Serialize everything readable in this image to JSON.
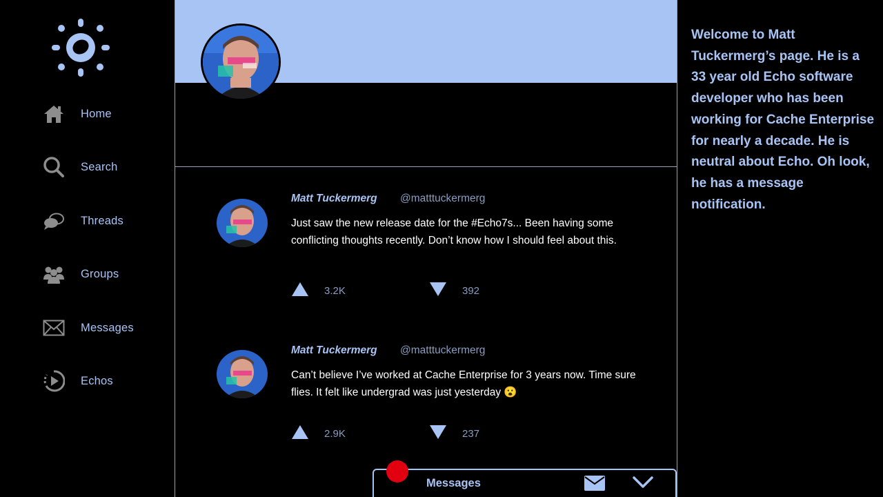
{
  "colors": {
    "accent": "#a8c4f5",
    "background": "#000000",
    "notification": "#e00010",
    "banner": "#a8c4f5"
  },
  "sidebar": {
    "logo_icon": "sun-logo-icon",
    "items": [
      {
        "label": "Home",
        "icon": "home-icon"
      },
      {
        "label": "Search",
        "icon": "search-icon"
      },
      {
        "label": "Threads",
        "icon": "chat-bubbles-icon"
      },
      {
        "label": "Groups",
        "icon": "groups-icon"
      },
      {
        "label": "Messages",
        "icon": "envelope-icon"
      },
      {
        "label": "Echos",
        "icon": "play-circle-icon"
      }
    ]
  },
  "posts": [
    {
      "name": "Matt Tuckermerg",
      "handle": "@matttuckermerg",
      "text": "Just saw the new release date for the #Echo7s... Been having some conflicting thoughts recently. Don’t know how I should feel about this.",
      "upvotes": "3.2K",
      "downvotes": "392"
    },
    {
      "name": "Matt Tuckermerg",
      "handle": "@matttuckermerg",
      "text": "Can’t believe I’ve worked at Cache Enterprise for 3 years now. Time sure flies. It felt like undergrad was just yesterday 😮",
      "upvotes": "2.9K",
      "downvotes": "237"
    }
  ],
  "welcome_text": "Welcome to Matt Tuckermerg’s page. He is a 33 year old Echo software developer who has been working for Cache Enterprise for nearly a decade. He is neutral about Echo. Oh look, he has a message notification.",
  "dock": {
    "label": "Messages"
  }
}
